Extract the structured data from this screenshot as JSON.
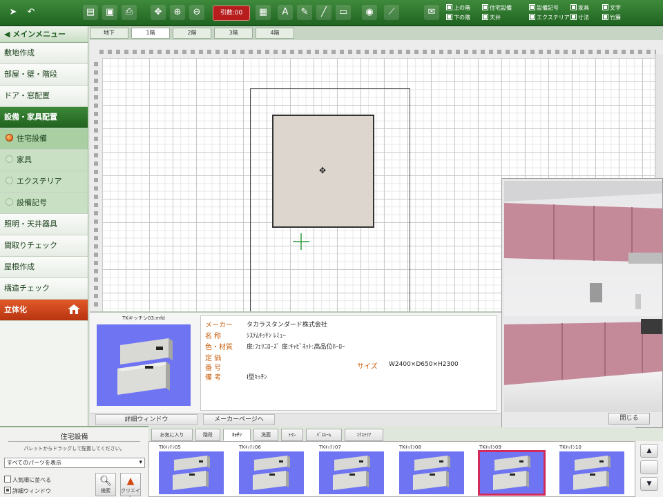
{
  "toolbar": {
    "red_button_label": "引数:00",
    "checkboxes": [
      {
        "label": "上の階",
        "checked": true
      },
      {
        "label": "住宅設備",
        "checked": true
      },
      {
        "label": "設備記号",
        "checked": true
      },
      {
        "label": "家具",
        "checked": true
      },
      {
        "label": "文字",
        "checked": true
      },
      {
        "label": "下の階",
        "checked": true
      },
      {
        "label": "天井",
        "checked": true
      },
      {
        "label": "エクステリア",
        "checked": true
      },
      {
        "label": "寸法",
        "checked": true
      },
      {
        "label": "竹簾",
        "checked": true
      }
    ]
  },
  "sidebar": {
    "header": "メインメニュー",
    "items": [
      {
        "label": "敷地作成",
        "type": "normal"
      },
      {
        "label": "部屋・壁・階段",
        "type": "normal"
      },
      {
        "label": "ドア・窓配置",
        "type": "normal"
      },
      {
        "label": "設備・家具配置",
        "type": "head"
      },
      {
        "label": "住宅設備",
        "type": "sub",
        "active": true
      },
      {
        "label": "家具",
        "type": "sub"
      },
      {
        "label": "エクステリア",
        "type": "sub"
      },
      {
        "label": "設備記号",
        "type": "sub"
      },
      {
        "label": "照明・天井器具",
        "type": "normal"
      },
      {
        "label": "間取りチェック",
        "type": "normal"
      },
      {
        "label": "屋根作成",
        "type": "normal"
      },
      {
        "label": "構造チェック",
        "type": "normal"
      },
      {
        "label": "立体化",
        "type": "solid"
      }
    ]
  },
  "floor_tabs": [
    "地下",
    "1階",
    "2階",
    "3階",
    "4階"
  ],
  "info": {
    "thumb_title": "TKキッチン03.mfd",
    "fields": {
      "maker_label": "メーカー",
      "maker_value": "タカラスタンダード株式会社",
      "name_label": "名 称",
      "name_value": "ｼｽﾃﾑｷｯﾁﾝ ﾚﾐｭｰ",
      "color_label": "色・材質",
      "color_value": "扉:ﾌｪﾘﾆﾛｰｽﾞ 扉:ｷｬﾋﾞﾈｯﾄ:高品位ﾎｰﾛｰ",
      "price_label": "定 価",
      "price_value": "",
      "type_label": "番 号",
      "type_value": "",
      "remarks_label": "備 考",
      "remarks_value": "I型ｷｯﾁﾝ",
      "size_label": "サイズ",
      "size_value": "W2400×D650×H2300"
    },
    "detail_button": "詳細ウィンドウ",
    "maker_button": "メーカーページへ"
  },
  "view3d": {
    "close_label": "閉じる"
  },
  "bottom_left": {
    "title": "住宅設備",
    "description": "パレットからドラッグして配置してください。",
    "select_value": "すべてのパーツを表示",
    "check1": "人気順に並べる",
    "check2": "詳細ウィンドウ",
    "search_label": "検索",
    "hand_label": "クリエイト"
  },
  "category_tabs": [
    "お気に入り",
    "階段",
    "ｷｯﾁﾝ",
    "洗面",
    "ﾄｲﾚ",
    "ﾊﾞｽﾙｰﾑ",
    "ｴｸｽﾃﾘｱ"
  ],
  "parts": [
    {
      "label": "TKｷｯﾁﾝ05",
      "selected": false
    },
    {
      "label": "TKｷｯﾁﾝ06",
      "selected": false
    },
    {
      "label": "TKｷｯﾁﾝ07",
      "selected": false
    },
    {
      "label": "TKｷｯﾁﾝ08",
      "selected": false
    },
    {
      "label": "TKｷｯﾁﾝ09",
      "selected": true
    },
    {
      "label": "TKｷｯﾁﾝ10",
      "selected": false
    }
  ],
  "colors": {
    "toolbar": "#2d7a2d",
    "accent_red": "#b71d1d",
    "solid_button": "#d44a1e",
    "thumb_bg": "#6e74f2",
    "selection": "#d22a5a"
  }
}
